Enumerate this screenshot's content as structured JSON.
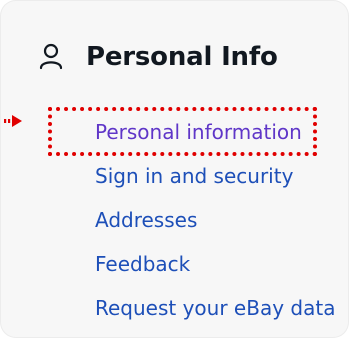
{
  "section": {
    "title": "Personal Info",
    "icon": "user-icon"
  },
  "nav": {
    "items": [
      {
        "label": "Personal information",
        "active": true
      },
      {
        "label": "Sign in and security"
      },
      {
        "label": "Addresses"
      },
      {
        "label": "Feedback"
      },
      {
        "label": "Request your eBay data"
      }
    ]
  },
  "colors": {
    "link": "#1d4fb8",
    "active_link": "#5f36c8",
    "highlight": "#e00000",
    "panel_background": "#f7f7f7",
    "title": "#111820"
  }
}
